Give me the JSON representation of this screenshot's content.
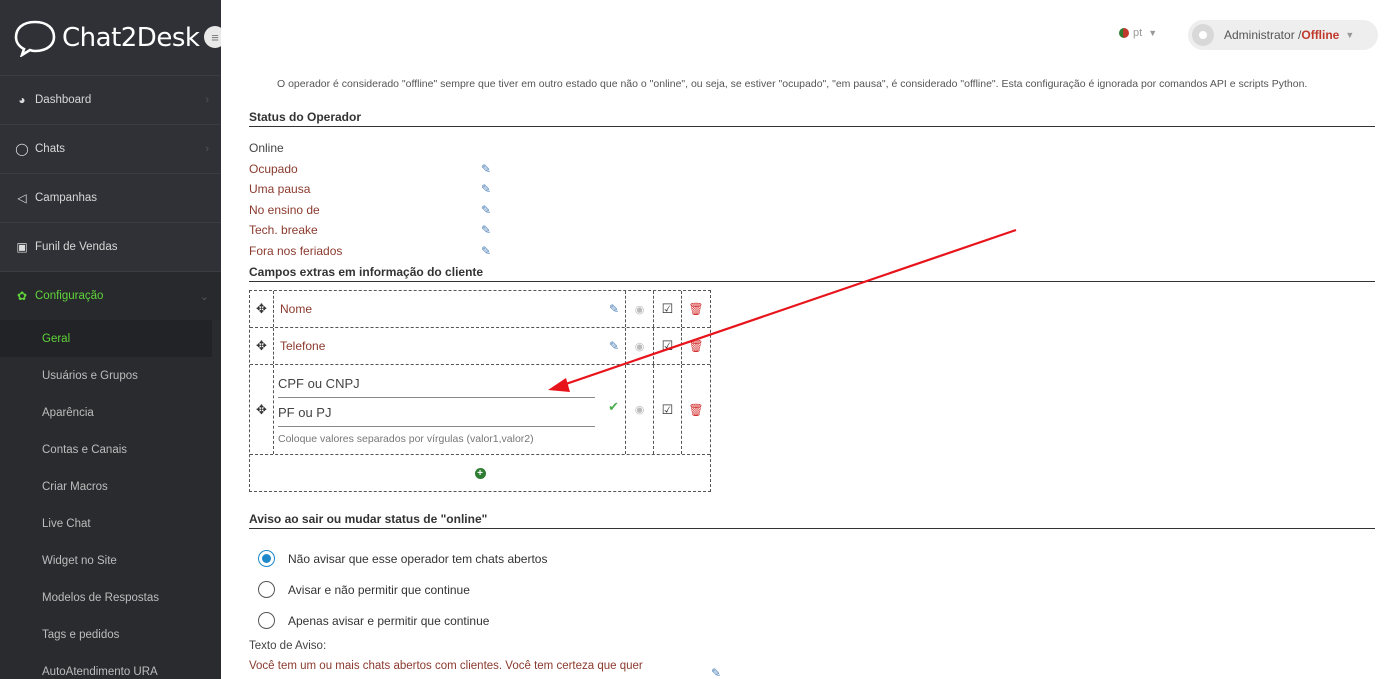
{
  "app": {
    "logo_text": "Chat2Desk"
  },
  "topbar": {
    "lang": "pt",
    "user": "Administrator / ",
    "status": "Offline"
  },
  "sidebar": {
    "items": [
      {
        "label": "Dashboard"
      },
      {
        "label": "Chats"
      },
      {
        "label": "Campanhas"
      },
      {
        "label": "Funil de Vendas"
      },
      {
        "label": "Configuração"
      }
    ],
    "sub_items": [
      {
        "label": "Geral"
      },
      {
        "label": "Usuários e Grupos"
      },
      {
        "label": "Aparência"
      },
      {
        "label": "Contas e Canais"
      },
      {
        "label": "Criar Macros"
      },
      {
        "label": "Live Chat"
      },
      {
        "label": "Widget no Site"
      },
      {
        "label": "Modelos de Respostas"
      },
      {
        "label": "Tags e pedidos"
      },
      {
        "label": "AutoAtendimento URA"
      }
    ]
  },
  "main": {
    "notice": "O operador é considerado \"offline\" sempre que tiver em outro estado que não o \"online\", ou seja, se estiver \"ocupado\", \"em pausa\", é considerado \"offline\". Esta configuração é ignorada por comandos API e scripts Python.",
    "status_title": "Status do Operador",
    "statuses": [
      "Online",
      "Ocupado",
      "Uma pausa",
      "No ensino de",
      "Tech. breake",
      "Fora nos feriados"
    ],
    "fields_title": "Campos extras em informação do cliente",
    "fields": [
      {
        "name": "Nome"
      },
      {
        "name": "Telefone"
      }
    ],
    "edit_field": {
      "name_value": "CPF ou CNPJ",
      "values_value": "PF ou PJ",
      "hint": "Coloque valores separados por vírgulas (valor1,valor2)"
    },
    "aviso_title": "Aviso ao sair ou mudar status de \"online\"",
    "options": [
      {
        "label": "Não avisar que esse operador tem chats abertos",
        "selected": true
      },
      {
        "label": "Avisar e não permitir que continue",
        "selected": false
      },
      {
        "label": "Apenas avisar e permitir que continue",
        "selected": false
      }
    ],
    "warn_label": "Texto de Aviso:",
    "warn_text": "Você tem um ou mais chats abertos com clientes. Você tem certeza que quer"
  },
  "colors": {
    "sidebar_bg": "#2f3136",
    "accent_green": "#5fd43a",
    "link_red": "#8b3a2e",
    "radio_blue": "#1e88c8",
    "arrow_red": "#e8141c"
  }
}
